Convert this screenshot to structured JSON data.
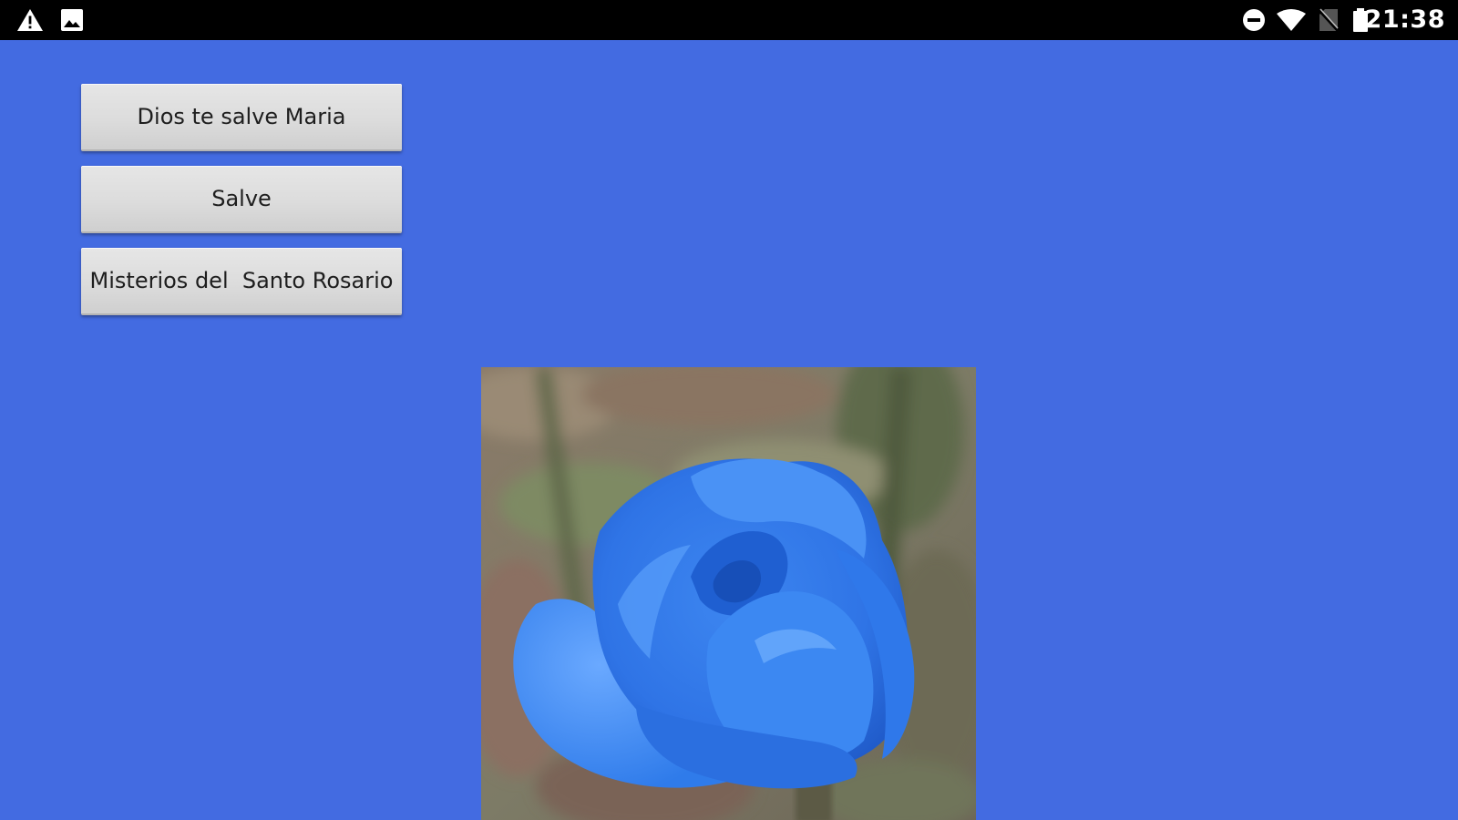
{
  "status_bar": {
    "time": "21:38",
    "left_icons": [
      "warning-icon",
      "image-icon"
    ],
    "right_icons": [
      "do-not-disturb-icon",
      "wifi-icon",
      "no-sim-icon",
      "battery-icon"
    ]
  },
  "buttons": [
    {
      "label": "Dios te salve Maria"
    },
    {
      "label": "Salve"
    },
    {
      "label": "Misterios del  Santo Rosario"
    }
  ],
  "image": {
    "subject": "blue-rose-photo"
  },
  "colors": {
    "background": "#436BE1",
    "status_bar": "#000000",
    "button_face": "#DCDCDC",
    "rose_blue": "#2F7BEA"
  }
}
